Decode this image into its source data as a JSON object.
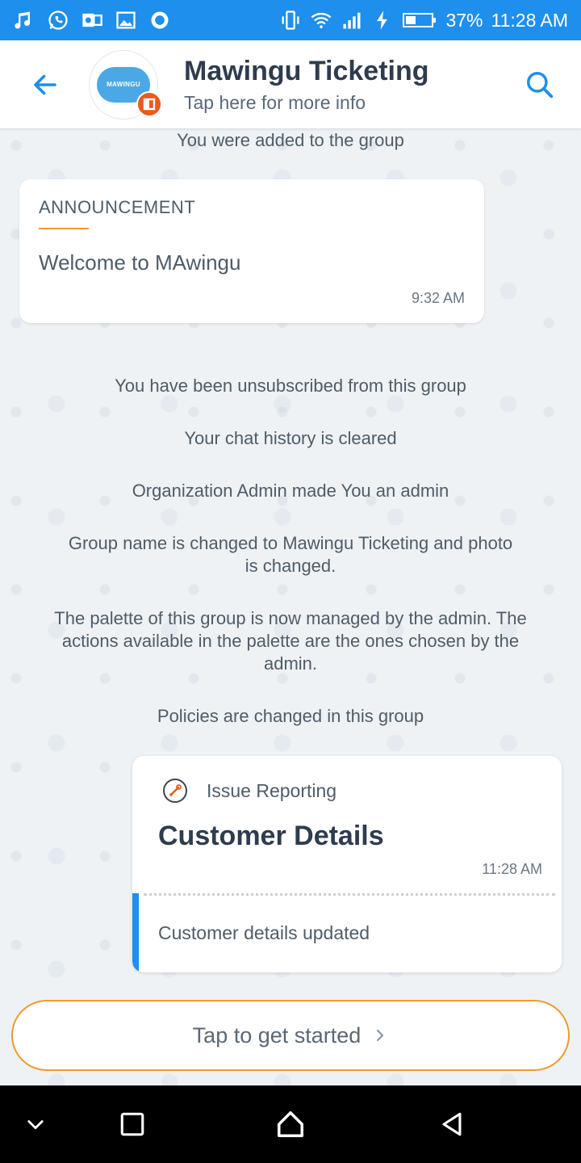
{
  "status_bar": {
    "battery_percent": "37%",
    "time": "11:28 AM",
    "left_icons": [
      "music-icon",
      "whatsapp-icon",
      "outlook-icon",
      "image-icon",
      "record-icon"
    ],
    "right_icons": [
      "vibrate-icon",
      "wifi-icon",
      "signal-icon",
      "charging-icon",
      "battery-icon"
    ]
  },
  "header": {
    "title": "Mawingu Ticketing",
    "subtitle": "Tap here for more info",
    "avatar_text": "MAWINGU",
    "back_icon": "back-arrow-icon",
    "search_icon": "search-icon"
  },
  "chat": {
    "added_notice": "You were added to the group",
    "announcement": {
      "label": "ANNOUNCEMENT",
      "text": "Welcome to MAwingu",
      "time": "9:32 AM"
    },
    "system_messages": [
      "You have been unsubscribed from this group",
      "Your chat history is cleared",
      "Organization Admin made You an admin",
      "Group name is changed to Mawingu Ticketing and photo is changed.",
      "The palette of this group is now managed by the admin. The actions available in the palette are the ones chosen by the admin.",
      "Policies are changed in this group"
    ],
    "card": {
      "app_name": "Issue Reporting",
      "title": "Customer Details",
      "time": "11:28 AM",
      "body": "Customer details updated"
    },
    "cta_label": "Tap to get started"
  },
  "colors": {
    "primary": "#1e8fec",
    "accent": "#ef9a2c",
    "office": "#ea5a1b"
  },
  "nav": [
    "collapse-icon",
    "recents-icon",
    "home-icon",
    "back-icon"
  ]
}
